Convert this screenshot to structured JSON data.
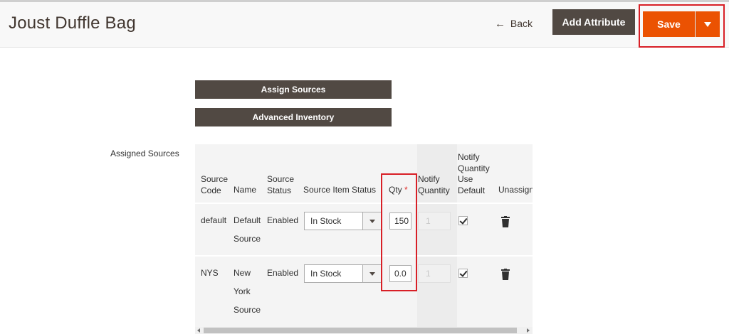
{
  "header": {
    "title": "Joust Duffle Bag",
    "back_label": "Back",
    "add_attribute_label": "Add Attribute",
    "save_label": "Save"
  },
  "buttons": {
    "assign_sources": "Assign Sources",
    "advanced_inventory": "Advanced Inventory"
  },
  "assigned_sources": {
    "label": "Assigned Sources",
    "columns": {
      "source_code": [
        "Source",
        "Code"
      ],
      "name": "Name",
      "source_status": [
        "Source",
        "Status"
      ],
      "source_item_status": "Source Item Status",
      "qty": "Qty",
      "qty_required_marker": "*",
      "notify_quantity": [
        "Notify",
        "Quantity"
      ],
      "notify_use_default": [
        "Notify",
        "Quantity",
        "Use",
        "Default"
      ],
      "unassign": "Unassign"
    },
    "rows": [
      {
        "source_code": "default",
        "name": [
          "Default",
          "Source"
        ],
        "source_status": "Enabled",
        "item_status": "In Stock",
        "qty": "150",
        "notify_qty": "1",
        "use_default_checked": true
      },
      {
        "source_code": "NYS",
        "name": [
          "New",
          "York",
          "Source"
        ],
        "source_status": "Enabled",
        "item_status": "In Stock",
        "qty": "0.0",
        "notify_qty": "1",
        "use_default_checked": true
      }
    ]
  },
  "colors": {
    "primary_orange": "#eb5202",
    "dark_button": "#514943",
    "highlight_red": "#d81f26"
  }
}
